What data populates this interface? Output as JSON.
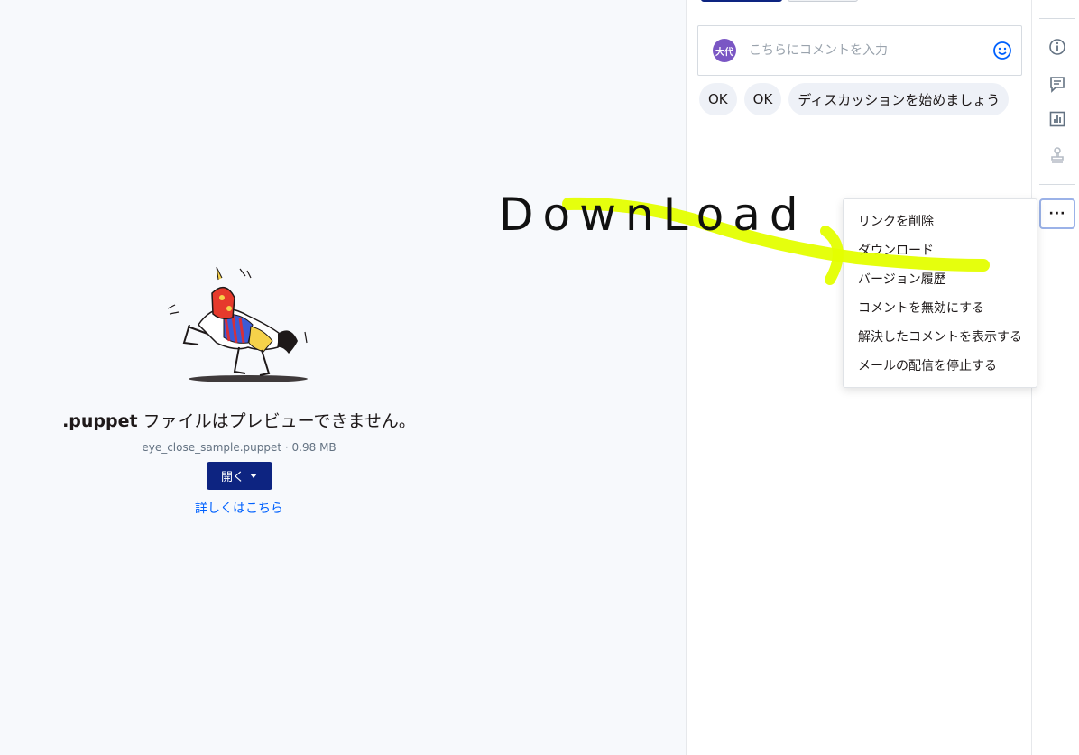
{
  "preview": {
    "title_ext": ".puppet",
    "title_rest": " ファイルはプレビューできません。",
    "file_meta": "eye_close_sample.puppet · 0.98 MB",
    "open_label": "開く",
    "learn_more": "詳しくはこちら"
  },
  "comments": {
    "avatar_initials": "大代",
    "placeholder": "こちらにコメントを入力",
    "quick_replies": [
      "OK",
      "OK",
      "ディスカッションを始めましょう"
    ]
  },
  "rail": {
    "icons": [
      "info-icon",
      "comment-icon",
      "chart-icon",
      "stamp-icon"
    ],
    "more_label": "···"
  },
  "menu": {
    "items": [
      "リンクを削除",
      "ダウンロード",
      "バージョン履歴",
      "コメントを無効にする",
      "解決したコメントを表示する",
      "メールの配信を停止する"
    ]
  },
  "annotation": {
    "text": "DownLoad",
    "color": "#e4ff00"
  }
}
